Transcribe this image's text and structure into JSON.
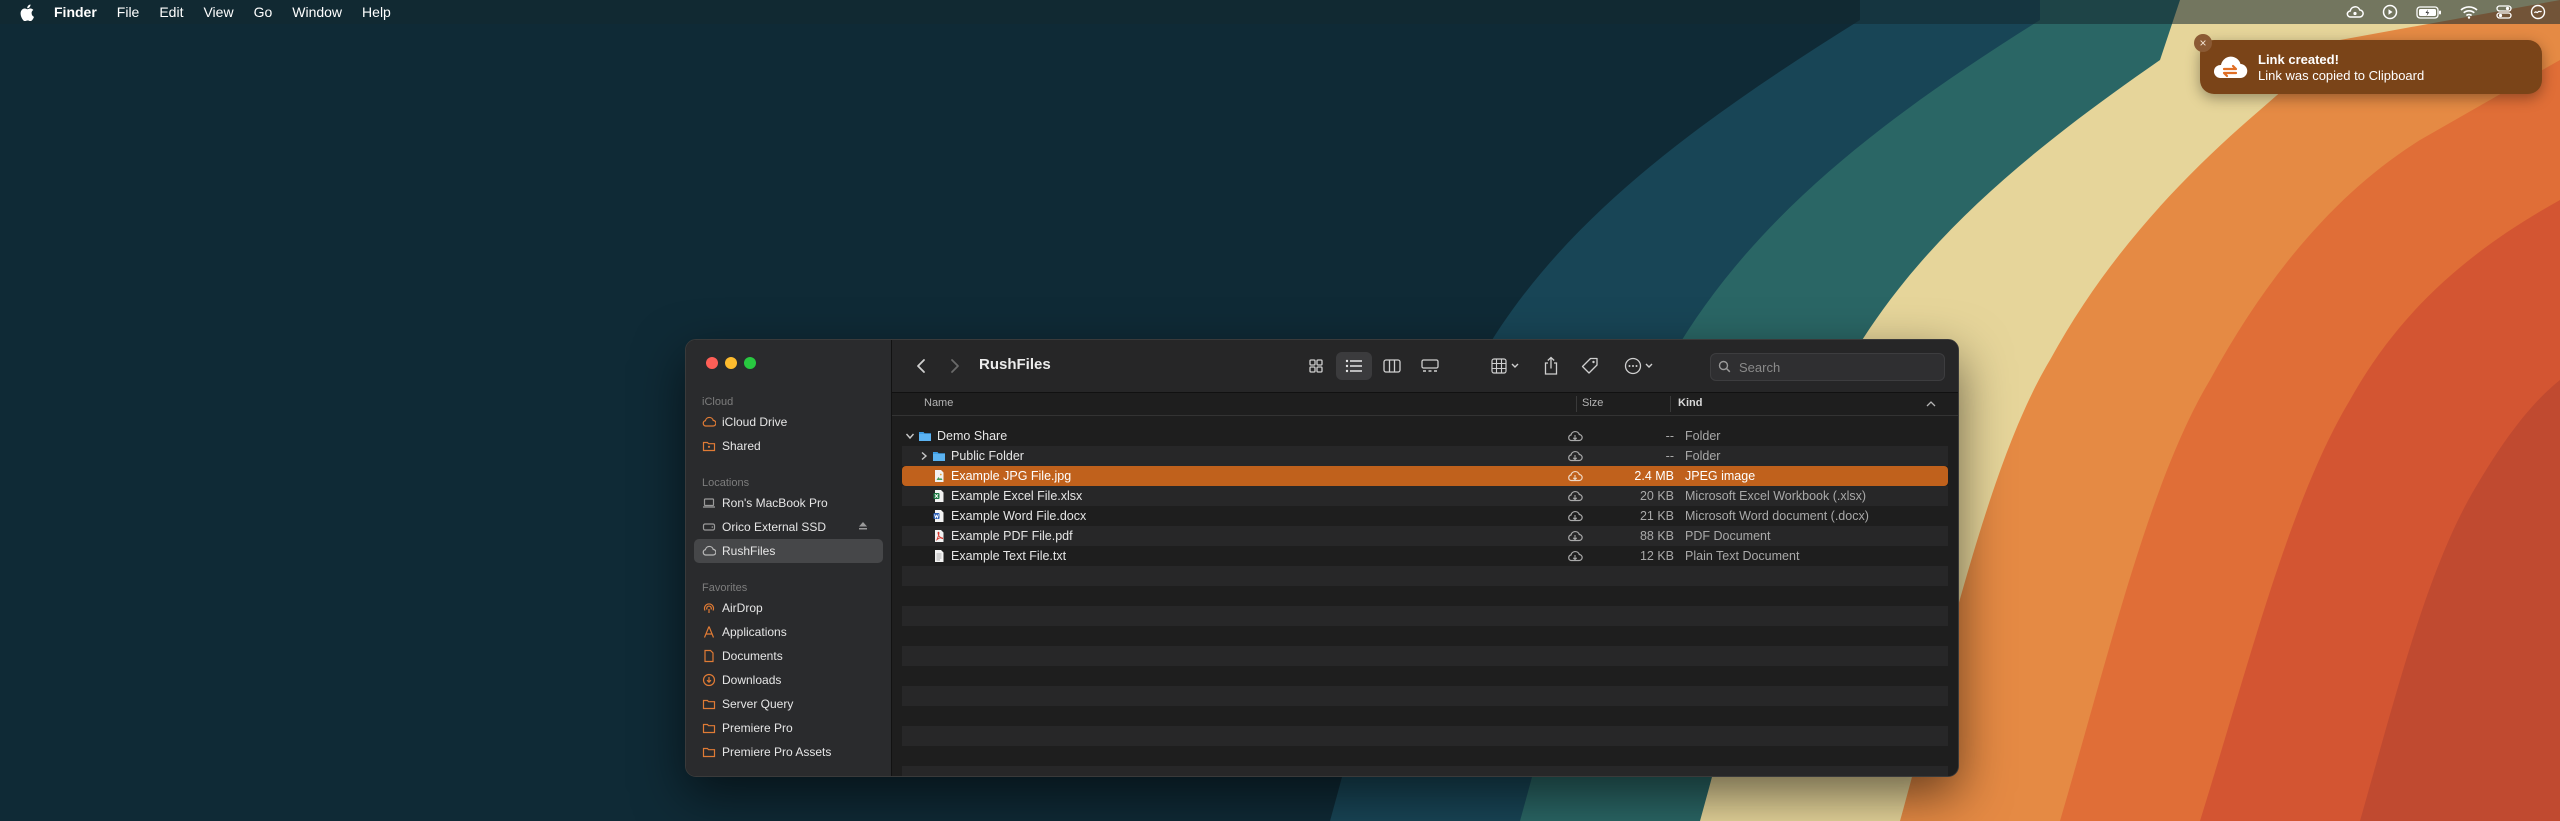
{
  "menubar": {
    "app_name": "Finder",
    "items": [
      "File",
      "Edit",
      "View",
      "Go",
      "Window",
      "Help"
    ]
  },
  "notification": {
    "title": "Link created!",
    "body": "Link was copied to Clipboard",
    "close_glyph": "×"
  },
  "finder": {
    "title": "RushFiles",
    "search_placeholder": "Search",
    "sidebar": {
      "sections": [
        {
          "header": "iCloud",
          "items": [
            {
              "label": "iCloud Drive",
              "icon": "cloud-icon"
            },
            {
              "label": "Shared",
              "icon": "shared-folder-icon"
            }
          ]
        },
        {
          "header": "Locations",
          "items": [
            {
              "label": "Ron's MacBook Pro",
              "icon": "laptop-icon"
            },
            {
              "label": "Orico External SSD",
              "icon": "drive-icon"
            },
            {
              "label": "RushFiles",
              "icon": "cloud-drive-icon"
            }
          ]
        },
        {
          "header": "Favorites",
          "items": [
            {
              "label": "AirDrop",
              "icon": "airdrop-icon"
            },
            {
              "label": "Applications",
              "icon": "applications-icon"
            },
            {
              "label": "Documents",
              "icon": "document-icon"
            },
            {
              "label": "Downloads",
              "icon": "downloads-icon"
            },
            {
              "label": "Server Query",
              "icon": "folder-icon"
            },
            {
              "label": "Premiere Pro",
              "icon": "folder-icon"
            },
            {
              "label": "Premiere Pro Assets",
              "icon": "folder-icon"
            }
          ]
        }
      ]
    },
    "columns": {
      "name": "Name",
      "size": "Size",
      "kind": "Kind"
    },
    "files": [
      {
        "name": "Demo Share",
        "size": "--",
        "kind": "Folder",
        "icon": "folder-icon",
        "expanded": true,
        "indent": 0
      },
      {
        "name": "Public Folder",
        "size": "--",
        "kind": "Folder",
        "icon": "folder-icon",
        "expanded": false,
        "indent": 1
      },
      {
        "name": "Example JPG File.jpg",
        "size": "2.4 MB",
        "kind": "JPEG image",
        "icon": "image-file-icon",
        "indent": 1,
        "selected": true
      },
      {
        "name": "Example Excel File.xlsx",
        "size": "20 KB",
        "kind": "Microsoft Excel Workbook (.xlsx)",
        "icon": "excel-file-icon",
        "indent": 1
      },
      {
        "name": "Example Word File.docx",
        "size": "21 KB",
        "kind": "Microsoft Word document (.docx)",
        "icon": "word-file-icon",
        "indent": 1
      },
      {
        "name": "Example PDF File.pdf",
        "size": "88 KB",
        "kind": "PDF Document",
        "icon": "pdf-file-icon",
        "indent": 1
      },
      {
        "name": "Example Text File.txt",
        "size": "12 KB",
        "kind": "Plain Text Document",
        "icon": "text-file-icon",
        "indent": 1
      }
    ]
  },
  "colors": {
    "accent": "#c0611c",
    "notification_bg": "#7a4418",
    "sidebar_accent": "#e07b35"
  }
}
